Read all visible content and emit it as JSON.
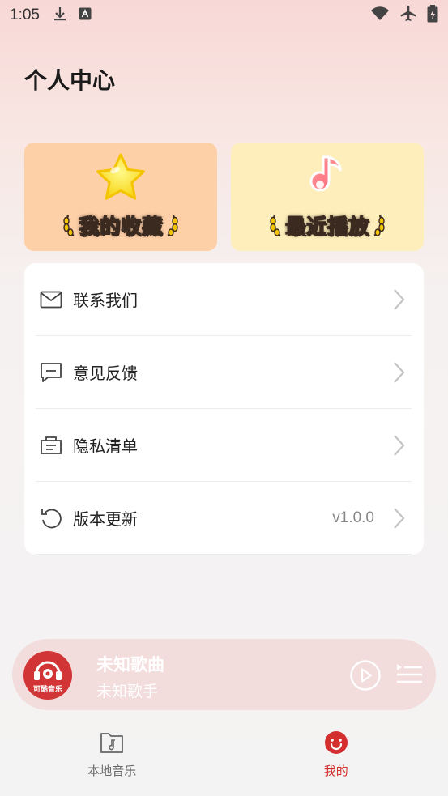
{
  "status_bar": {
    "time": "1:05",
    "icons": [
      "download-icon",
      "a-badge-icon",
      "wifi-icon",
      "airplane-icon",
      "battery-icon"
    ]
  },
  "page": {
    "title": "个人中心"
  },
  "cards": {
    "favorites": {
      "label": "我的收藏",
      "icon": "star-icon",
      "bg": "#fed0a8"
    },
    "recent": {
      "label": "最近播放",
      "icon": "music-note-icon",
      "bg": "#fdeebb"
    }
  },
  "menu": {
    "items": [
      {
        "label": "联系我们",
        "icon": "mail-icon",
        "value": ""
      },
      {
        "label": "意见反馈",
        "icon": "feedback-icon",
        "value": ""
      },
      {
        "label": "隐私清单",
        "icon": "privacy-list-icon",
        "value": ""
      },
      {
        "label": "版本更新",
        "icon": "refresh-icon",
        "value": "v1.0.0"
      }
    ]
  },
  "player": {
    "cover_text": "可酷音乐",
    "song_title": "未知歌曲",
    "artist": "未知歌手"
  },
  "bottom_nav": {
    "items": [
      {
        "label": "本地音乐",
        "icon": "folder-music-icon",
        "active": false
      },
      {
        "label": "我的",
        "icon": "smile-icon",
        "active": true
      }
    ],
    "active_color": "#d32f2f"
  }
}
